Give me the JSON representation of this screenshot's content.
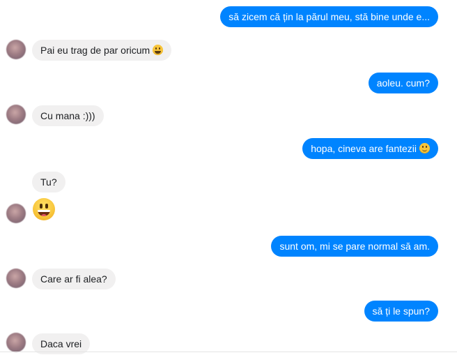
{
  "conversation": {
    "messages": [
      {
        "direction": "outgoing",
        "text": "să zicem că țin la părul meu, stă bine unde e..."
      },
      {
        "direction": "incoming",
        "text": "Pai eu trag de par oricum",
        "emoji": "grinning-face"
      },
      {
        "direction": "outgoing",
        "text": "aoleu. cum?"
      },
      {
        "direction": "incoming",
        "text": "Cu mana :)))"
      },
      {
        "direction": "outgoing",
        "text": "hopa, cineva are fantezii",
        "emoji": "slightly-smiling-face"
      },
      {
        "direction": "incoming",
        "text": "Tu?"
      },
      {
        "direction": "incoming",
        "emoji": "grinning-face-large"
      },
      {
        "direction": "outgoing",
        "text": "sunt om, mi se pare normal să am."
      },
      {
        "direction": "incoming",
        "text": "Care ar fi alea?"
      },
      {
        "direction": "outgoing",
        "text": "să ți le spun?"
      },
      {
        "direction": "incoming",
        "text": "Daca vrei"
      }
    ]
  },
  "colors": {
    "outgoing_bubble": "#0084ff",
    "incoming_bubble": "#f1f0f0"
  }
}
